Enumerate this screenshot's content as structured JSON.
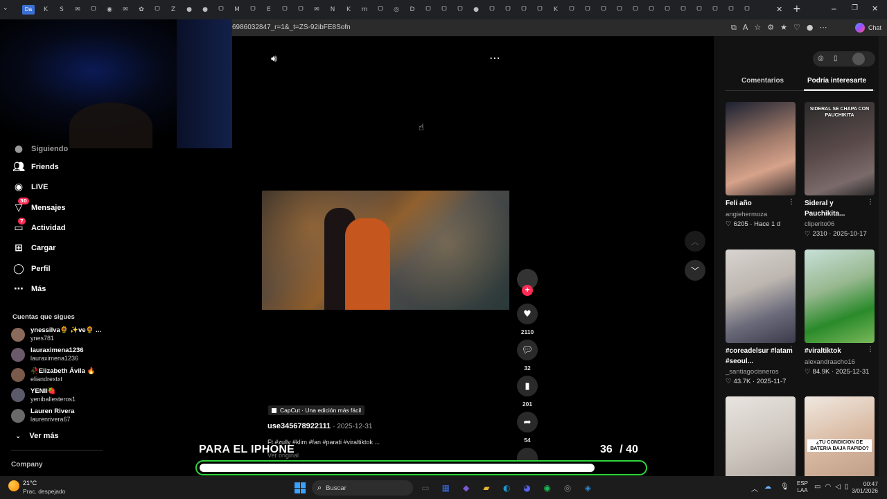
{
  "browser": {
    "first_tab": "Da",
    "url": "6986032847_r=1&_t=ZS-92ibFE8Sofn",
    "chat_label": "Chat"
  },
  "sidebar": {
    "partial_item": "Siguiendo",
    "items": [
      {
        "label": "Friends",
        "icon": "friends-icon"
      },
      {
        "label": "LIVE",
        "icon": "live-icon"
      },
      {
        "label": "Mensajes",
        "icon": "messages-icon",
        "badge": "30"
      },
      {
        "label": "Actividad",
        "icon": "activity-icon",
        "badge": "7"
      },
      {
        "label": "Cargar",
        "icon": "upload-icon"
      },
      {
        "label": "Perfil",
        "icon": "profile-icon"
      },
      {
        "label": "Más",
        "icon": "more-icon"
      }
    ],
    "following_title": "Cuentas que sigues",
    "following": [
      {
        "name": "ynessilva🌻 ✨ve🌻 ...",
        "handle": "ynes781"
      },
      {
        "name": "lauraximena1236",
        "handle": "lauraximena1236"
      },
      {
        "name": "🥀Elizabeth Ávila 🔥",
        "handle": "eliandrextxt"
      },
      {
        "name": "YENII🍓",
        "handle": "yeniballesteros1"
      },
      {
        "name": "Lauren Rivera",
        "handle": "laurenrivera67"
      }
    ],
    "see_more": "Ver más",
    "company": "Company"
  },
  "video": {
    "capcut_label": "CapCut · Una edición más fácil",
    "author": "use345678922111",
    "date": "2025-12-31",
    "caption": "Ft.#zully #klim #fan #parati #viraltiktok ...",
    "original": "Ver original",
    "likes": "2110",
    "comments": "32",
    "saves": "201",
    "shares": "54"
  },
  "overlay": {
    "text": "PARA EL IPHONE",
    "count": "36",
    "total": "/ 40",
    "progress": 0.89
  },
  "right_panel": {
    "tabs": [
      "Comentarios",
      "Podría interesarte"
    ],
    "active_tab": 1,
    "cards": [
      {
        "title": "Feli año",
        "user": "angiehermoza",
        "likes": "6205",
        "date": "Hace 1 d",
        "thumb_text": ""
      },
      {
        "title": "Sideral y Pauchikita...",
        "user": "cliperito06",
        "likes": "2310",
        "date": "2025-10-17",
        "thumb_text": "SIDERAL SE CHAPA CON PAUCHIKITA"
      },
      {
        "title": "#coreadelsur #latam #seoul...",
        "user": "_santiagocisneros",
        "likes": "43.7K",
        "date": "2025-11-7",
        "thumb_text": ""
      },
      {
        "title": "#viraltiktok",
        "user": "alexandraacho16",
        "likes": "84.9K",
        "date": "2025-12-31",
        "thumb_text": ""
      },
      {
        "title": "",
        "user": "",
        "likes": "",
        "date": "",
        "thumb_text": ""
      },
      {
        "title": "",
        "user": "",
        "likes": "",
        "date": "",
        "thumb_text": "¿TU CONDICION DE BATERIA BAJA RAPIDO?"
      }
    ]
  },
  "taskbar": {
    "temp": "21°C",
    "weather": "Prac. despejado",
    "search": "Buscar",
    "lang1": "ESP",
    "lang2": "LAA",
    "time": "00:47",
    "date": "3/01/2026"
  }
}
